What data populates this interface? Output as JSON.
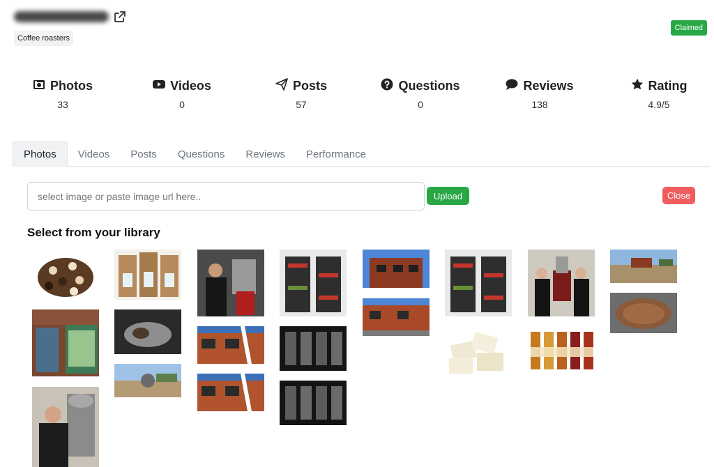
{
  "business": {
    "category": "Coffee roasters",
    "status_badge": "Claimed"
  },
  "stats": [
    {
      "label": "Photos",
      "value": "33",
      "icon": "camera-icon"
    },
    {
      "label": "Videos",
      "value": "0",
      "icon": "youtube-icon"
    },
    {
      "label": "Posts",
      "value": "57",
      "icon": "paper-plane-icon"
    },
    {
      "label": "Questions",
      "value": "0",
      "icon": "question-circle-icon"
    },
    {
      "label": "Reviews",
      "value": "138",
      "icon": "comment-icon"
    },
    {
      "label": "Rating",
      "value": "4.9/5",
      "icon": "star-icon"
    }
  ],
  "tabs": [
    "Photos",
    "Videos",
    "Posts",
    "Questions",
    "Reviews",
    "Performance"
  ],
  "active_tab": "Photos",
  "uploader": {
    "placeholder": "select image or paste image url here..",
    "upload_label": "Upload",
    "close_label": "Close"
  },
  "library": {
    "title": "Select from your library",
    "photos": [
      "coffee-beans-photo",
      "coffee-bags-photo",
      "roaster-operator-photo",
      "shop-shelves-photo",
      "brick-building-photo",
      "shop-shelves-photo",
      "owners-with-roaster-photo",
      "panorama-photo",
      "shopfront-window-photo",
      "roaster-drum-photo",
      "building-corner-photo",
      "coffee-dispensers-photo",
      "building-street-photo",
      "nougat-photo",
      "syrup-bottles-photo",
      "roasted-beans-photo",
      "panorama-yard-photo",
      "building-corner-photo",
      "coffee-dispensers-photo",
      "man-with-roaster-photo"
    ]
  },
  "colors": {
    "accent_green": "#28a745",
    "close_red": "#f05d5e"
  }
}
